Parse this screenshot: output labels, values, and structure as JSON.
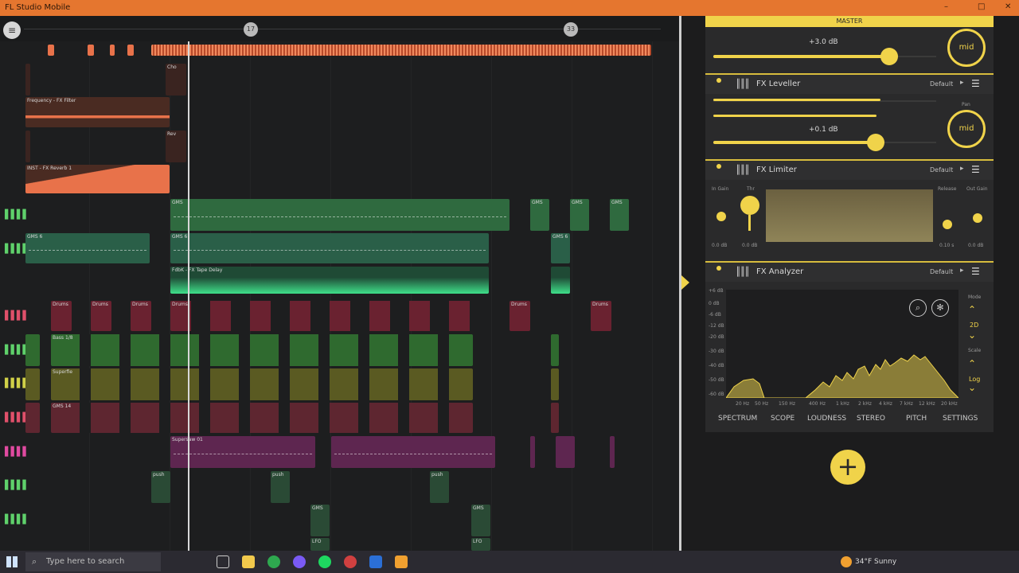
{
  "window": {
    "title": "FL Studio Mobile",
    "minimize": "–",
    "maximize": "□",
    "close": "✕"
  },
  "topbar": {
    "menu_icon": "hamburger-icon",
    "markers": [
      "17",
      "33"
    ]
  },
  "automation_labels": [
    "Frequency - FX Filter",
    "INST - FX Reverb 1",
    "Cho",
    "Rev"
  ],
  "clips": {
    "row1": "GMS",
    "row2": "GMS 6",
    "delay": "FdbK - FX Tape Delay",
    "drums": "Drums",
    "bass": "Bass 1/8",
    "super": "Superfie",
    "gms14": "GMS 14",
    "supersaw": "Supersaw 01",
    "push": "push",
    "gms_small": "GMS",
    "lfo": "LFO"
  },
  "mixer": {
    "master_label": "MASTER",
    "master_gain": "+3.0 dB",
    "master_gain_level": 0.82,
    "fx": [
      {
        "name": "FX Leveller",
        "preset": "Default"
      },
      {
        "name": "FX Limiter",
        "preset": "Default"
      },
      {
        "name": "FX Analyzer",
        "preset": "Default"
      }
    ],
    "leveller_gain": "+0.1 dB",
    "leveller_gain_level": 0.76,
    "pan_label": "Pan",
    "mid_label": "mid",
    "limiter": {
      "in_gain": "In Gain",
      "thr": "Thr",
      "release": "Release",
      "out_gain": "Out Gain",
      "in_val": "0.0 dB",
      "thr_val": "0.0 dB",
      "release_val": "0.10 s",
      "out_val": "0.0 dB"
    },
    "analyzer": {
      "db_ticks": [
        "+6 dB",
        "0 dB",
        "-6 dB",
        "-12 dB",
        "-20 dB",
        "-30 dB",
        "-40 dB",
        "-50 dB",
        "-60 dB"
      ],
      "freq_ticks": [
        "20 Hz",
        "50 Hz",
        "150 Hz",
        "400 Hz",
        "1 kHz",
        "2 kHz",
        "4 kHz",
        "7 kHz",
        "12 kHz",
        "20 kHz"
      ],
      "mode_label": "Mode",
      "mode_value": "2D",
      "scale_label": "Scale",
      "scale_value": "Log"
    },
    "tabs": [
      "SPECTRUM",
      "SCOPE",
      "LOUDNESS",
      "STEREO",
      "PITCH",
      "SETTINGS"
    ],
    "add_label": "+"
  },
  "taskbar": {
    "search_placeholder": "Type here to search",
    "weather": "34°F Sunny"
  }
}
